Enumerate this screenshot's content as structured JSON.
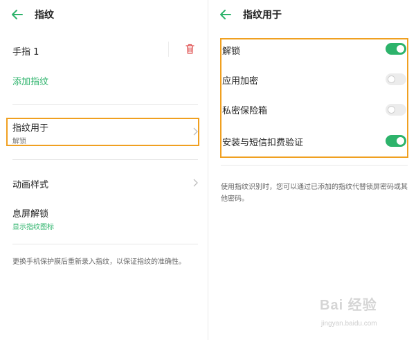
{
  "left": {
    "title": "指纹",
    "finger_name": "手指 1",
    "add_fingerprint": "添加指纹",
    "usage_label": "指纹用于",
    "usage_value": "解锁",
    "animation_label": "动画样式",
    "screen_off_label": "息屏解锁",
    "screen_off_sub": "显示指纹图标",
    "note": "更换手机保护膜后重新录入指纹，以保证指纹的准确性。"
  },
  "right": {
    "title": "指纹用于",
    "options": [
      {
        "label": "解锁",
        "enabled": true
      },
      {
        "label": "应用加密",
        "enabled": false
      },
      {
        "label": "私密保险箱",
        "enabled": false
      },
      {
        "label": "安装与短信扣费验证",
        "enabled": true
      }
    ],
    "note": "使用指纹识别时，您可以通过已添加的指纹代替锁屏密码或其他密码。"
  },
  "watermark": {
    "logo": "Bai 经验",
    "url": "jingyan.baidu.com"
  },
  "colors": {
    "accent": "#2db36b",
    "highlight": "#f0a020",
    "delete": "#e05555"
  },
  "icons": {
    "back": "arrow-left-icon",
    "delete": "trash-icon",
    "chevron": "chevron-right-icon"
  }
}
